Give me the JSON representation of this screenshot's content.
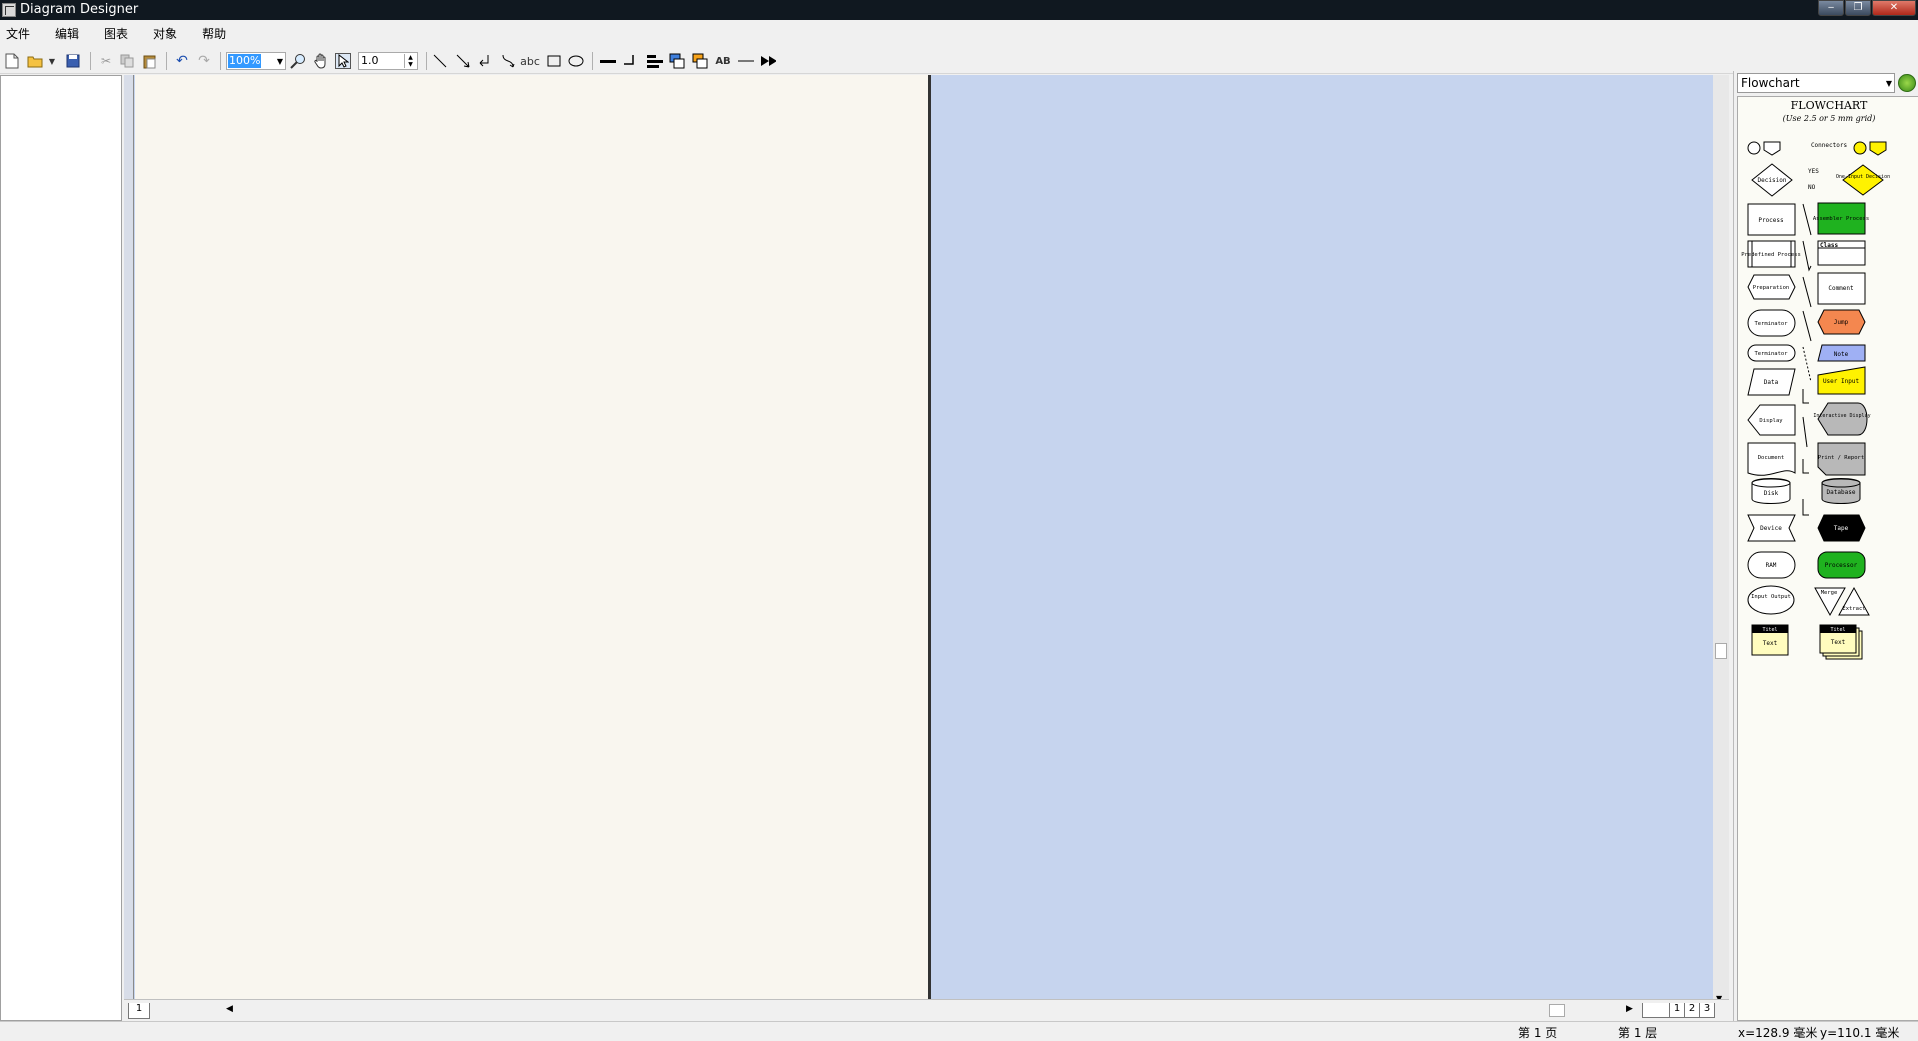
{
  "window": {
    "title": "Diagram Designer",
    "buttons": [
      "‒",
      "❐",
      "✕"
    ]
  },
  "menu": [
    "文件",
    "编辑",
    "图表",
    "对象",
    "帮助"
  ],
  "toolbar": {
    "zoom": "100%",
    "line_width": "1.0",
    "text_tool": "abc"
  },
  "left_ruler_tab": "1",
  "page_tabs": [
    "",
    "1",
    "2",
    "3"
  ],
  "palette": {
    "selected": "Flowchart",
    "title": "FLOWCHART",
    "subtitle": "(Use 2.5 or 5 mm grid)",
    "connectors_label": "Connectors",
    "yes": "YES",
    "no": "NO",
    "left": [
      "Decision",
      "Process",
      "Predefined Process",
      "Preparation",
      "Terminator",
      "Terminator",
      "Data",
      "Display",
      "Document",
      "Disk",
      "Device",
      "RAM",
      "Input Output",
      "Titel",
      "Text"
    ],
    "right": [
      "One-Input Decision",
      "Assembler Process",
      "Class",
      "Comment",
      "Jump",
      "Note",
      "User Input",
      "Interactive Display",
      "Print / Report",
      "Database",
      "Tape",
      "Processor",
      "Merge",
      "Extract",
      "Titel",
      "Text"
    ]
  },
  "status": {
    "page": "第 1 页",
    "layer": "第 1 层",
    "x": "x=128.9 毫米",
    "y": "y=110.1 毫米"
  },
  "colors": {
    "canvas_bg": "#c6d4ee",
    "page_bg": "#f9f6ef",
    "green": "#1fb21f",
    "orange": "#f4874f",
    "blue_note": "#9fb0f4",
    "yellow": "#fff200",
    "gray": "#b8b8b8"
  }
}
